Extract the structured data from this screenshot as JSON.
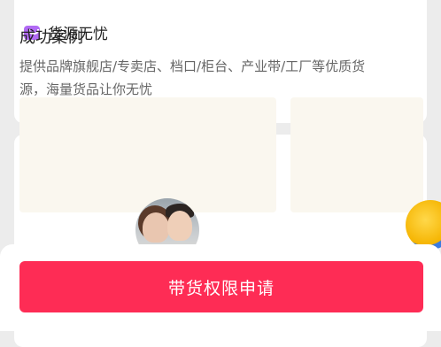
{
  "feature": {
    "icon": "bag-icon",
    "title": "货源无忧",
    "description": "提供品牌旗舰店/专卖店、档口/柜台、产业带/工厂等优质货源，海量货品让你无忧"
  },
  "cases": {
    "title": "成功案例"
  },
  "footer": {
    "apply_label": "带货权限申请"
  },
  "colors": {
    "accent": "#fe2c55",
    "icon_purple": "#b16af4"
  }
}
